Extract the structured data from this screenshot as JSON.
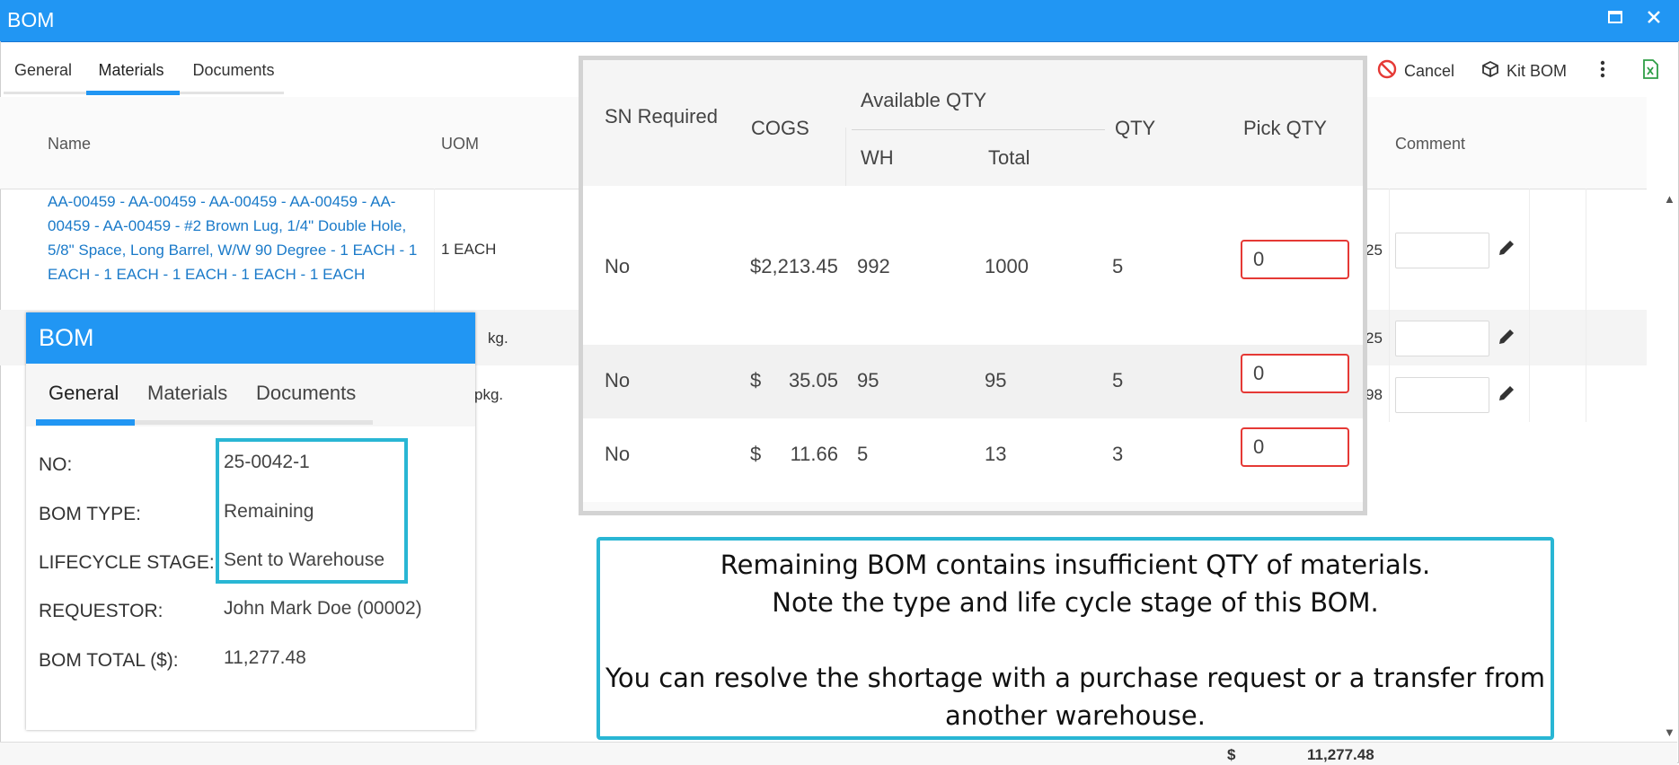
{
  "window": {
    "title": "BOM",
    "maximize_icon": "maximize-icon",
    "close_icon": "close-icon"
  },
  "tabs": [
    {
      "label": "General"
    },
    {
      "label": "Materials"
    },
    {
      "label": "Documents"
    }
  ],
  "active_tab": "Materials",
  "toolbar": {
    "cancel_label": "Cancel",
    "kit_bom_label": "Kit BOM"
  },
  "table": {
    "headers": {
      "name": "Name",
      "uom": "UOM",
      "comment": "Comment"
    },
    "rows": [
      {
        "name": "AA-00459 - AA-00459 - AA-00459 - AA-00459 - AA-00459 - AA-00459 - #2 Brown Lug, 1/4\" Double Hole, 5/8\" Space, Long Barrel, W/W 90 Degree - 1 EACH - 1 EACH - 1 EACH - 1 EACH - 1 EACH - 1 EACH",
        "uom": "1 EACH",
        "partial": "25"
      },
      {
        "name": "",
        "uom": "kg.",
        "partial": "25"
      },
      {
        "name": "",
        "uom": "pkg.",
        "partial": "98"
      }
    ],
    "footer_total_currency": "$",
    "footer_total": "11,277.48"
  },
  "zoom_table": {
    "headers": {
      "sn_required": "SN Required",
      "cogs": "COGS",
      "available_qty": "Available QTY",
      "wh": "WH",
      "total": "Total",
      "qty": "QTY",
      "pick_qty": "Pick QTY"
    },
    "rows": [
      {
        "sn": "No",
        "cogs_currency": "",
        "cogs": "$2,213.45",
        "wh": "992",
        "total": "1000",
        "qty": "5",
        "pick": "0"
      },
      {
        "sn": "No",
        "cogs_currency": "$",
        "cogs": "35.05",
        "wh": "95",
        "total": "95",
        "qty": "5",
        "pick": "0"
      },
      {
        "sn": "No",
        "cogs_currency": "$",
        "cogs": "11.66",
        "wh": "5",
        "total": "13",
        "qty": "3",
        "pick": "0"
      }
    ]
  },
  "bom_popup": {
    "title": "BOM",
    "tabs": [
      {
        "label": "General"
      },
      {
        "label": "Materials"
      },
      {
        "label": "Documents"
      }
    ],
    "active_tab": "General",
    "fields": [
      {
        "label": "NO:",
        "value": "25-0042-1"
      },
      {
        "label": "BOM TYPE:",
        "value": "Remaining"
      },
      {
        "label": "LIFECYCLE STAGE:",
        "value": "Sent to Warehouse"
      },
      {
        "label": "REQUESTOR:",
        "value": "John Mark Doe (00002)"
      },
      {
        "label": "BOM TOTAL ($):",
        "value": "11,277.48"
      }
    ]
  },
  "note": {
    "line1": "Remaining BOM contains insufficient QTY of materials.",
    "line2": "Note the type and life cycle stage of this BOM.",
    "line3": "You can resolve the shortage with a purchase request or a transfer from",
    "line4": "another warehouse."
  },
  "colors": {
    "accent": "#2196f3",
    "highlight": "#29b6d4",
    "error": "#e53935",
    "link": "#1a7ac9"
  }
}
